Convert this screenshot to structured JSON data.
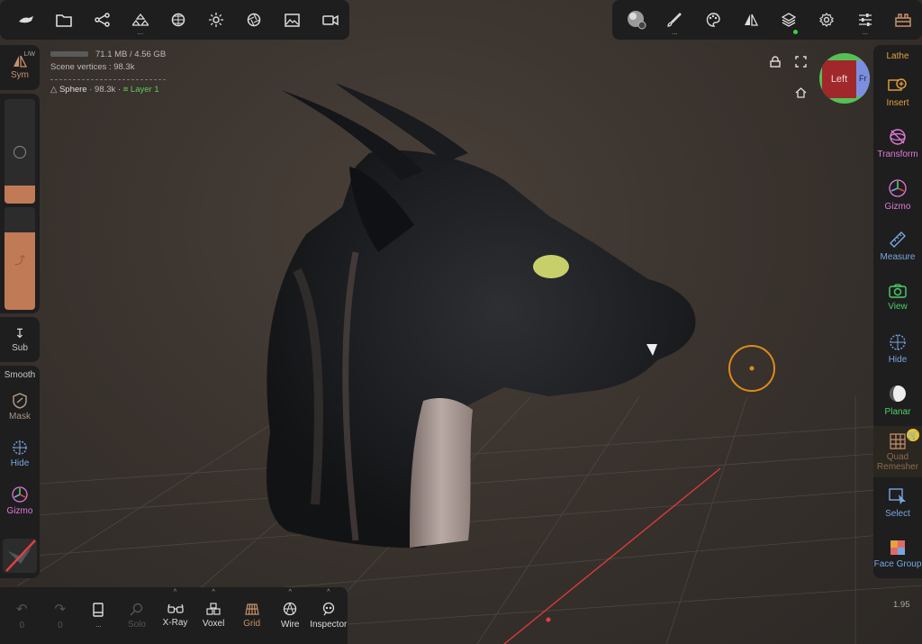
{
  "colors": {
    "accent": "#c9916a",
    "green": "#4ccf6c",
    "orange": "#e6a23c",
    "pink": "#e07ad8",
    "blue": "#7aa6e0",
    "bg": "#1e1e1e"
  },
  "stats": {
    "memory": "71.1 MB / 4.56 GB",
    "vertices": "Scene vertices : 98.3k",
    "object": "Sphere",
    "object_verts": "· 98.3k ·",
    "layer": "Layer 1"
  },
  "top_left": [
    {
      "icon": "nomad-logo-icon"
    },
    {
      "icon": "folder-icon"
    },
    {
      "icon": "scene-tree-icon"
    },
    {
      "icon": "primitives-icon",
      "more": "..."
    },
    {
      "icon": "topology-icon"
    },
    {
      "icon": "light-icon"
    },
    {
      "icon": "camera-aperture-icon"
    },
    {
      "icon": "image-icon"
    },
    {
      "icon": "video-icon"
    }
  ],
  "top_right": [
    {
      "icon": "material-sphere-icon"
    },
    {
      "icon": "brush-icon",
      "more": "..."
    },
    {
      "icon": "palette-icon"
    },
    {
      "icon": "symmetry-icon"
    },
    {
      "icon": "layers-icon"
    },
    {
      "icon": "settings-icon"
    },
    {
      "icon": "sliders-icon",
      "more": "..."
    },
    {
      "icon": "toolbox-icon"
    }
  ],
  "left_tools": {
    "sym": "Sym",
    "sym_badge": "L/W",
    "sub": "Sub",
    "smooth": "Smooth",
    "mask": "Mask",
    "hide": "Hide",
    "gizmo": "Gizmo"
  },
  "right_tools": [
    {
      "label": "Lathe",
      "color": "#e6a23c",
      "icon": "lathe-icon"
    },
    {
      "label": "Insert",
      "color": "#e6a23c",
      "icon": "insert-icon"
    },
    {
      "label": "Transform",
      "color": "#e07ad8",
      "icon": "transform-icon"
    },
    {
      "label": "Gizmo",
      "color": "#e07ad8",
      "icon": "gizmo-icon"
    },
    {
      "label": "Measure",
      "color": "#7aa6e0",
      "icon": "ruler-icon"
    },
    {
      "label": "View",
      "color": "#4ccf6c",
      "icon": "camera-icon"
    },
    {
      "label": "Hide",
      "color": "#7aa6e0",
      "icon": "hide-icon"
    },
    {
      "label": "Planar",
      "color": "#4ccf6c",
      "icon": "planar-icon"
    },
    {
      "label": "Quad Remesher",
      "color": "#c9916a",
      "icon": "quad-remesher-icon"
    },
    {
      "label": "Select",
      "color": "#7aa6e0",
      "icon": "select-icon"
    },
    {
      "label": "Face Group",
      "color": "#7aa6e0",
      "icon": "face-group-icon"
    }
  ],
  "bottom": {
    "undo": "0",
    "redo": "0",
    "more": "...",
    "solo": "Solo",
    "xray": "X-Ray",
    "voxel": "Voxel",
    "grid": "Grid",
    "wire": "Wire",
    "inspector": "Inspector"
  },
  "gizmo_cube": {
    "left": "Left",
    "front": "Fr"
  },
  "zoom": "1.95"
}
